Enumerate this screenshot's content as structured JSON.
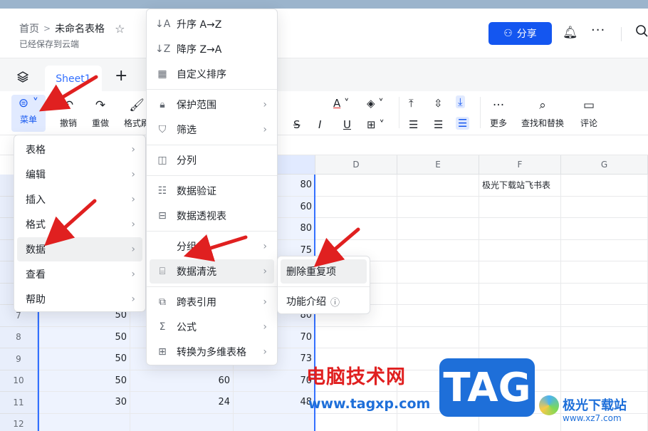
{
  "header": {
    "home": "首页",
    "title": "未命名表格",
    "saved": "已经保存到云端",
    "share_label": "分享"
  },
  "tabs": [
    {
      "label": "Sheet1"
    }
  ],
  "toolbar": {
    "menu": "菜单",
    "undo": "撤销",
    "redo": "重做",
    "format": "格式刷",
    "more": "更多",
    "find_replace": "查找和替换",
    "comment": "评论"
  },
  "columns": [
    "D",
    "E",
    "F",
    "G"
  ],
  "rows": [
    {
      "num": "",
      "a": "",
      "b": "",
      "c": "80"
    },
    {
      "num": "",
      "a": "",
      "b": "",
      "c": "60"
    },
    {
      "num": "",
      "a": "",
      "b": "",
      "c": "80"
    },
    {
      "num": "",
      "a": "",
      "b": "",
      "c": "75"
    },
    {
      "num": "",
      "a": "",
      "b": "",
      "c": ""
    },
    {
      "num": "",
      "a": "",
      "b": "",
      "c": ""
    },
    {
      "num": "7",
      "a": "50",
      "b": "",
      "c": "80"
    },
    {
      "num": "8",
      "a": "50",
      "b": "",
      "c": "70"
    },
    {
      "num": "9",
      "a": "50",
      "b": "",
      "c": "73"
    },
    {
      "num": "10",
      "a": "50",
      "b": "60",
      "c": "70"
    },
    {
      "num": "11",
      "a": "30",
      "b": "24",
      "c": "48"
    },
    {
      "num": "12",
      "a": "",
      "b": "",
      "c": ""
    }
  ],
  "f1_text": "极光下载站飞书表",
  "menu1": {
    "items": [
      {
        "label": "表格"
      },
      {
        "label": "编辑"
      },
      {
        "label": "插入"
      },
      {
        "label": "格式"
      },
      {
        "label": "数据"
      },
      {
        "label": "查看"
      },
      {
        "label": "帮助"
      }
    ]
  },
  "menu2": {
    "items": [
      {
        "label": "升序 A→Z"
      },
      {
        "label": "降序 Z→A"
      },
      {
        "label": "自定义排序"
      },
      {
        "label": "保护范围"
      },
      {
        "label": "筛选"
      },
      {
        "label": "分列"
      },
      {
        "label": "数据验证"
      },
      {
        "label": "数据透视表"
      },
      {
        "label": "分组"
      },
      {
        "label": "数据清洗"
      },
      {
        "label": "跨表引用"
      },
      {
        "label": "公式"
      },
      {
        "label": "转换为多维表格"
      }
    ]
  },
  "menu3": {
    "items": [
      {
        "label": "删除重复项"
      },
      {
        "label": "功能介绍"
      }
    ]
  },
  "watermark": {
    "brand": "电脑技术网",
    "url": "www.tagxp.com",
    "tag": "TAG",
    "jg": "极光下载站",
    "jg_url": "www.xz7.com"
  },
  "colors": {
    "accent": "#1456f0",
    "arrow": "#e02020"
  }
}
